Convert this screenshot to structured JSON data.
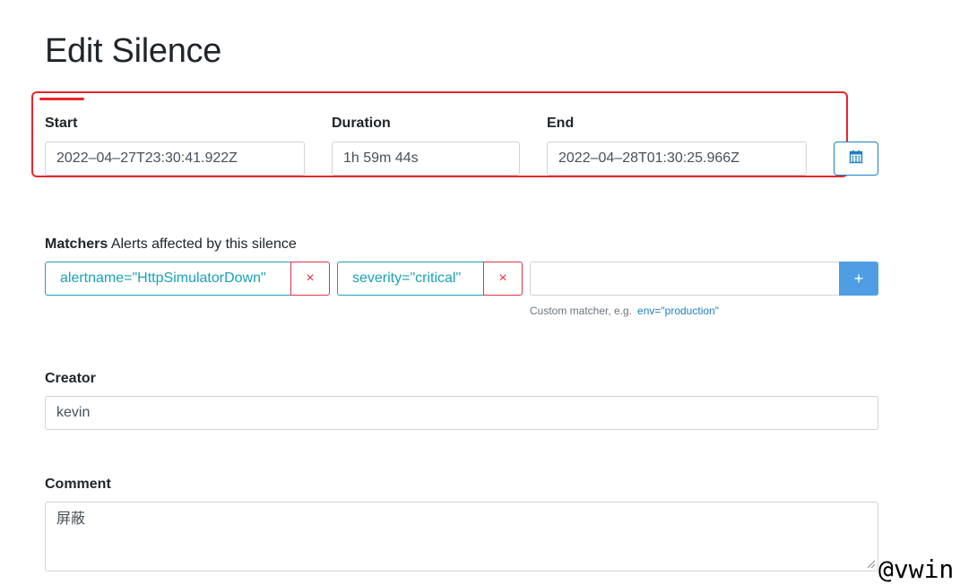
{
  "page": {
    "title": "Edit Silence"
  },
  "time": {
    "start_label": "Start",
    "start_value": "2022–04–27T23:30:41.922Z",
    "duration_label": "Duration",
    "duration_value": "1h 59m 44s",
    "end_label": "End",
    "end_value": "2022–04–28T01:30:25.966Z",
    "calendar_icon": "calendar-icon"
  },
  "matchers": {
    "heading": "Matchers",
    "subheading": "Alerts affected by this silence",
    "items": [
      {
        "text": "alertname=\"HttpSimulatorDown\"",
        "remove": "×"
      },
      {
        "text": "severity=\"critical\"",
        "remove": "×"
      }
    ],
    "new_value": "",
    "add_label": "+",
    "hint_text": "Custom matcher, e.g.",
    "hint_example": "env=\"production\""
  },
  "creator": {
    "label": "Creator",
    "value": "kevin"
  },
  "comment": {
    "label": "Comment",
    "value": "屏蔽"
  },
  "watermark": "@vwin",
  "colors": {
    "annotation": "#e8262a",
    "chip": "#17a2b8",
    "remove": "#dc3545",
    "primary": "#4f9ee3",
    "link": "#1b7fc4"
  }
}
